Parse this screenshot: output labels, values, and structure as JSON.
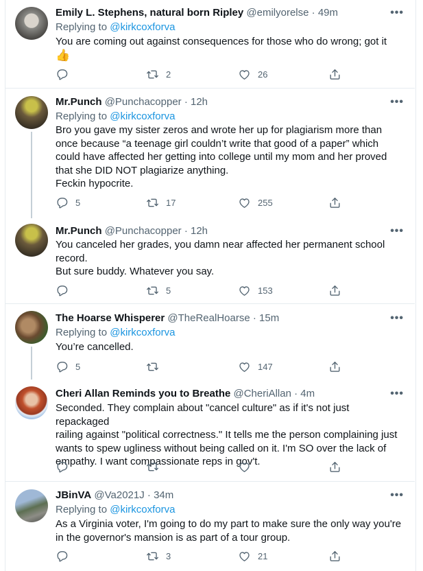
{
  "tweets": [
    {
      "name": "Emily L. Stephens, natural born Ripley",
      "handle": "@emilyorelse",
      "time": "· 49m",
      "replying_prefix": "Replying to ",
      "replying_to": "@kirkcoxforva",
      "text_lines": [
        "You are coming out against consequences for those who do wrong; got it"
      ],
      "emoji": "👍",
      "reply_count": "",
      "retweet_count": "2",
      "like_count": "26"
    },
    {
      "name": "Mr.Punch",
      "handle": "@Punchacopper",
      "time": "· 12h",
      "replying_prefix": "Replying to ",
      "replying_to": "@kirkcoxforva",
      "text_lines": [
        "Bro you gave my sister zeros and wrote her up for plagiarism more than",
        "once because “a teenage girl couldn’t write that good of a paper” which",
        "could have affected her getting into college until my mom and her proved",
        "that she DID NOT plagiarize anything.",
        "Feckin hypocrite."
      ],
      "reply_count": "5",
      "retweet_count": "17",
      "like_count": "255"
    },
    {
      "name": "Mr.Punch",
      "handle": "@Punchacopper",
      "time": "· 12h",
      "text_lines": [
        "You canceled her grades, you damn near affected her permanent school",
        "record.",
        "But sure buddy. Whatever you say."
      ],
      "reply_count": "",
      "retweet_count": "5",
      "like_count": "153"
    },
    {
      "name": "The Hoarse Whisperer",
      "handle": "@TheRealHoarse",
      "time": "· 15m",
      "replying_prefix": "Replying to ",
      "replying_to": "@kirkcoxforva",
      "text_lines": [
        "You’re cancelled."
      ],
      "reply_count": "5",
      "retweet_count": "",
      "like_count": "147"
    },
    {
      "name": "Cheri Allan Reminds you to Breathe",
      "handle": "@CheriAllan",
      "time": "· 4m",
      "text_lines": [
        "Seconded. They complain about \"cancel culture\" as if it's not just repackaged",
        "railing against \"political correctness.\" It tells me the person complaining just",
        "wants to spew ugliness without being called on it. I'm SO over the lack of",
        "empathy. I want compassionate reps in gov't."
      ],
      "reply_count": "",
      "retweet_count": "",
      "like_count": ""
    },
    {
      "name": "JBinVA",
      "handle": "@Va2021J",
      "time": "· 34m",
      "replying_prefix": "Replying to ",
      "replying_to": "@kirkcoxforva",
      "text_lines": [
        "As a Virginia voter, I'm going to do my part to make sure the only way you're",
        "in the governor's mansion is as part of a tour group."
      ],
      "reply_count": "",
      "retweet_count": "3",
      "like_count": "21"
    }
  ],
  "more_label": "•••",
  "icons": {
    "reply": "reply-icon",
    "retweet": "retweet-icon",
    "like": "heart-icon",
    "share": "share-icon"
  },
  "colors": {
    "mention": "#1b95e0",
    "secondary": "#536471",
    "thread_line": "#c4cfd6",
    "divider": "#e6ecf0"
  }
}
